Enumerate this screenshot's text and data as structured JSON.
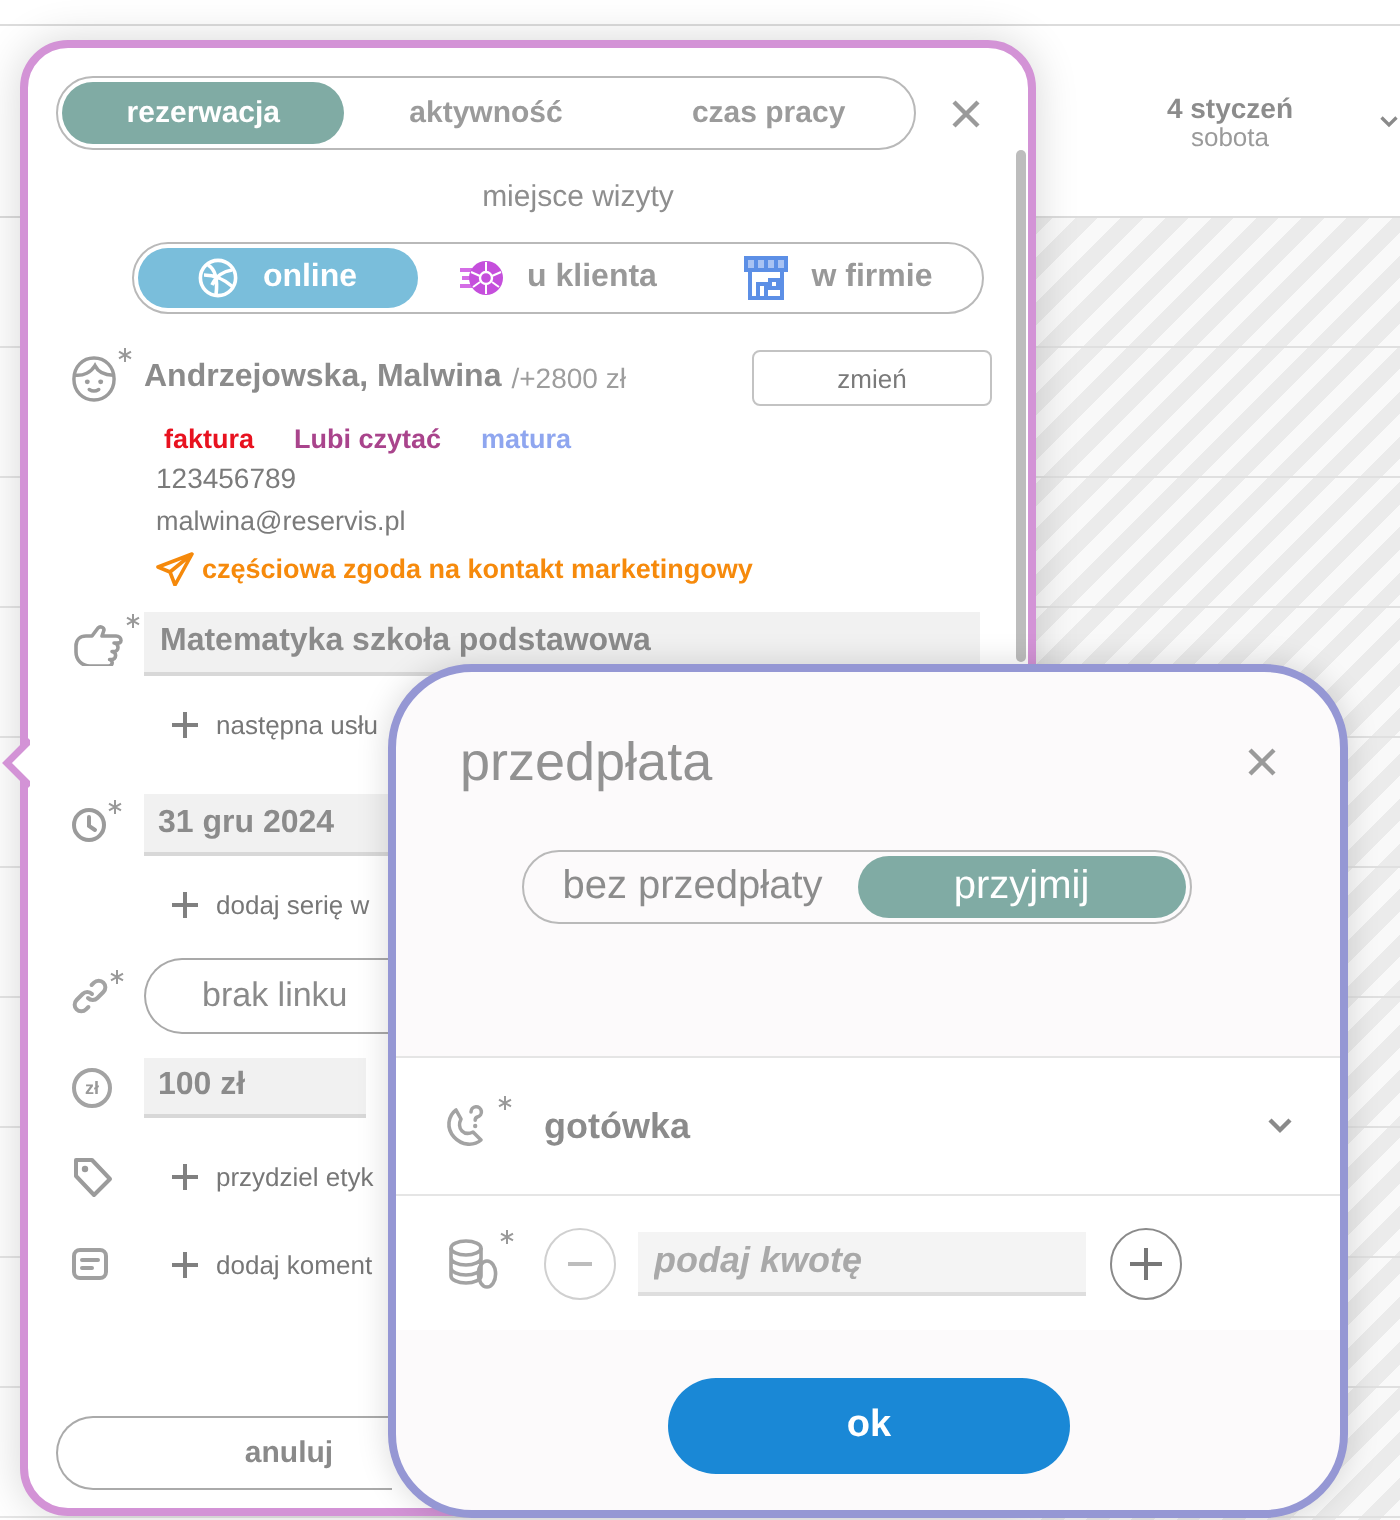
{
  "calendar": {
    "date": "4 styczeń",
    "weekday": "sobota"
  },
  "booking_panel": {
    "tabs": [
      {
        "label": "rezerwacja",
        "selected": true
      },
      {
        "label": "aktywność",
        "selected": false
      },
      {
        "label": "czas pracy",
        "selected": false
      }
    ],
    "visit_place": {
      "label": "miejsce wizyty",
      "options": [
        {
          "label": "online",
          "kind": "online",
          "selected": true
        },
        {
          "label": "u klienta",
          "kind": "client",
          "selected": false
        },
        {
          "label": "w firmie",
          "kind": "office",
          "selected": false
        }
      ]
    },
    "client": {
      "required": true,
      "name": "Andrzejowska, Malwina",
      "balance": "/+2800 zł",
      "change_button": "zmień",
      "tags": [
        {
          "label": "faktura",
          "color": "#e8121f"
        },
        {
          "label": "Lubi czytać",
          "color": "#a9448c"
        },
        {
          "label": "matura",
          "color": "#8fa6ef"
        }
      ],
      "phone": "123456789",
      "email": "malwina@reservis.pl",
      "marketing_consent": "częściowa zgoda na kontakt marketingowy"
    },
    "service": {
      "required": true,
      "value": "Matematyka szkoła podstawowa",
      "add_link": "następna usłu"
    },
    "date": {
      "required": true,
      "value": "31 gru 2024",
      "add_link": "dodaj serię w"
    },
    "meeting_link": {
      "required": true,
      "value": "brak linku"
    },
    "price": {
      "currency_symbol": "zł",
      "value": "100 zł"
    },
    "labels": {
      "add_link": "przydziel etyk"
    },
    "comment": {
      "add_link": "dodaj koment"
    },
    "cancel_button": "anuluj"
  },
  "prepayment_dialog": {
    "title": "przedpłata",
    "options": [
      {
        "label": "bez przedpłaty",
        "selected": false
      },
      {
        "label": "przyjmij",
        "selected": true
      }
    ],
    "payment_method": {
      "required": true,
      "value": "gotówka"
    },
    "amount": {
      "required": true,
      "placeholder": "podaj kwotę"
    },
    "ok_button": "ok"
  }
}
